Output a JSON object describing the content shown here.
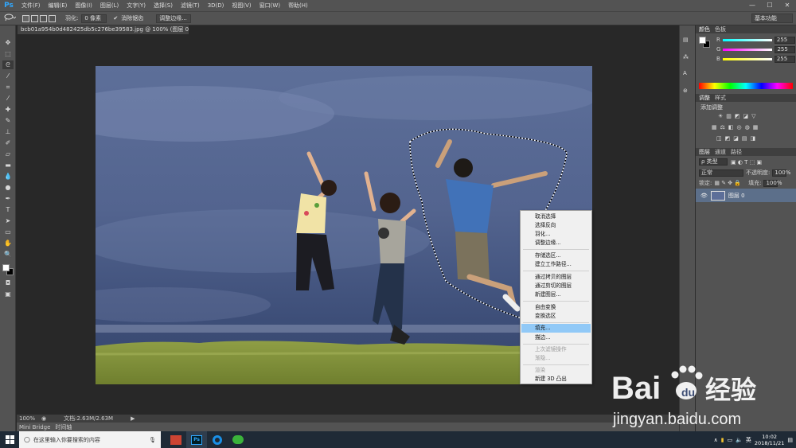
{
  "app": {
    "logo": "Ps"
  },
  "menu": [
    "文件(F)",
    "编辑(E)",
    "图像(I)",
    "图层(L)",
    "文字(Y)",
    "选择(S)",
    "滤镜(T)",
    "3D(D)",
    "视图(V)",
    "窗口(W)",
    "帮助(H)"
  ],
  "window_controls": [
    "—",
    "☐",
    "✕"
  ],
  "options": {
    "feather_label": "羽化:",
    "feather_value": "0 像素",
    "antialias_label": "消除锯齿",
    "refine_edge": "调整边缘...",
    "workspace": "基本功能"
  },
  "document": {
    "tab": "bcb01a954b0d482425db5c276be39583.jpg @ 100% (图层 0, RGB/8#) *",
    "zoom": "100%",
    "doc_size": "文档:2.63M/2.63M"
  },
  "bottom_tabs": [
    "Mini Bridge",
    "时间轴"
  ],
  "panels": {
    "color_tabs": [
      "颜色",
      "色板"
    ],
    "rgb": [
      {
        "ch": "R",
        "value": "255"
      },
      {
        "ch": "G",
        "value": "255"
      },
      {
        "ch": "B",
        "value": "255"
      }
    ],
    "adjust_tabs": [
      "调整",
      "样式"
    ],
    "adjust_title": "添加调整",
    "layers_tabs": [
      "图层",
      "通道",
      "路径"
    ],
    "kind_label": "ρ 类型",
    "blend_mode": "正常",
    "opacity_label": "不透明度:",
    "opacity_value": "100%",
    "lock_label": "锁定:",
    "fill_label": "填充:",
    "fill_value": "100%",
    "layer_name": "图层 0"
  },
  "context_menu": {
    "items": [
      {
        "label": "取消选择",
        "state": "normal"
      },
      {
        "label": "选择反向",
        "state": "normal"
      },
      {
        "label": "羽化...",
        "state": "normal"
      },
      {
        "label": "调整边缘...",
        "state": "normal"
      },
      {
        "label": "存储选区...",
        "state": "normal"
      },
      {
        "label": "建立工作路径...",
        "state": "normal"
      },
      {
        "label": "通过拷贝的图层",
        "state": "normal"
      },
      {
        "label": "通过剪切的图层",
        "state": "normal"
      },
      {
        "label": "新建图层...",
        "state": "normal"
      },
      {
        "label": "自由变换",
        "state": "normal"
      },
      {
        "label": "变换选区",
        "state": "normal"
      },
      {
        "label": "填充...",
        "state": "highlighted"
      },
      {
        "label": "描边...",
        "state": "normal"
      },
      {
        "label": "上次滤镜操作",
        "state": "disabled"
      },
      {
        "label": "渐隐...",
        "state": "disabled"
      },
      {
        "label": "渲染",
        "state": "disabled"
      },
      {
        "label": "新建 3D 凸出",
        "state": "normal"
      }
    ]
  },
  "taskbar": {
    "search_placeholder": "在这里输入你要搜索的内容",
    "lang": "英",
    "time": "10:02",
    "date": "2018/11/21"
  },
  "watermark": {
    "brand": "Bai",
    "brand_cn": "经验",
    "url": "jingyan.baidu.com"
  },
  "colors": {
    "ps_blue": "#31a8ff",
    "menu_bg": "#535353",
    "highlight": "#91c9f7",
    "layer_sel": "#5c6f8a"
  }
}
